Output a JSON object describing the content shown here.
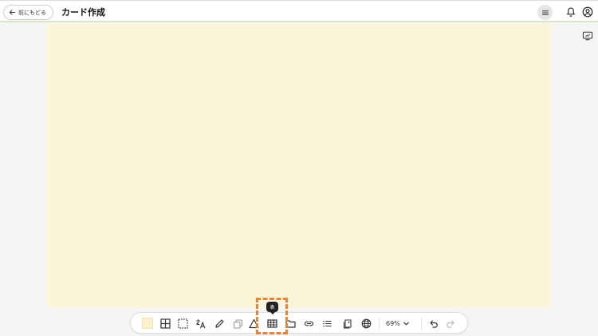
{
  "header": {
    "back_label": "前にもどる",
    "title": "カード作成"
  },
  "icons": {
    "back": "arrow-left-icon",
    "menu": "hamburger-menu-icon",
    "notifications": "bell-icon",
    "account": "account-circle-icon",
    "presentation": "presentation-icon"
  },
  "canvas": {
    "background_color": "#fbf6d9"
  },
  "toolbar": {
    "swatch_color": "#fbf3cf",
    "tools": [
      "background-color-icon",
      "grid-icon",
      "selection-icon",
      "text-icon",
      "pen-icon",
      "layers-icon",
      "shape-icon",
      "table-icon",
      "folder-icon",
      "link-icon",
      "list-icon",
      "image-icon",
      "globe-icon"
    ],
    "zoom_label": "69%",
    "undo": "undo-icon",
    "redo": "redo-icon"
  },
  "tooltip": {
    "label": "表"
  },
  "highlight_color": "#e8843a"
}
